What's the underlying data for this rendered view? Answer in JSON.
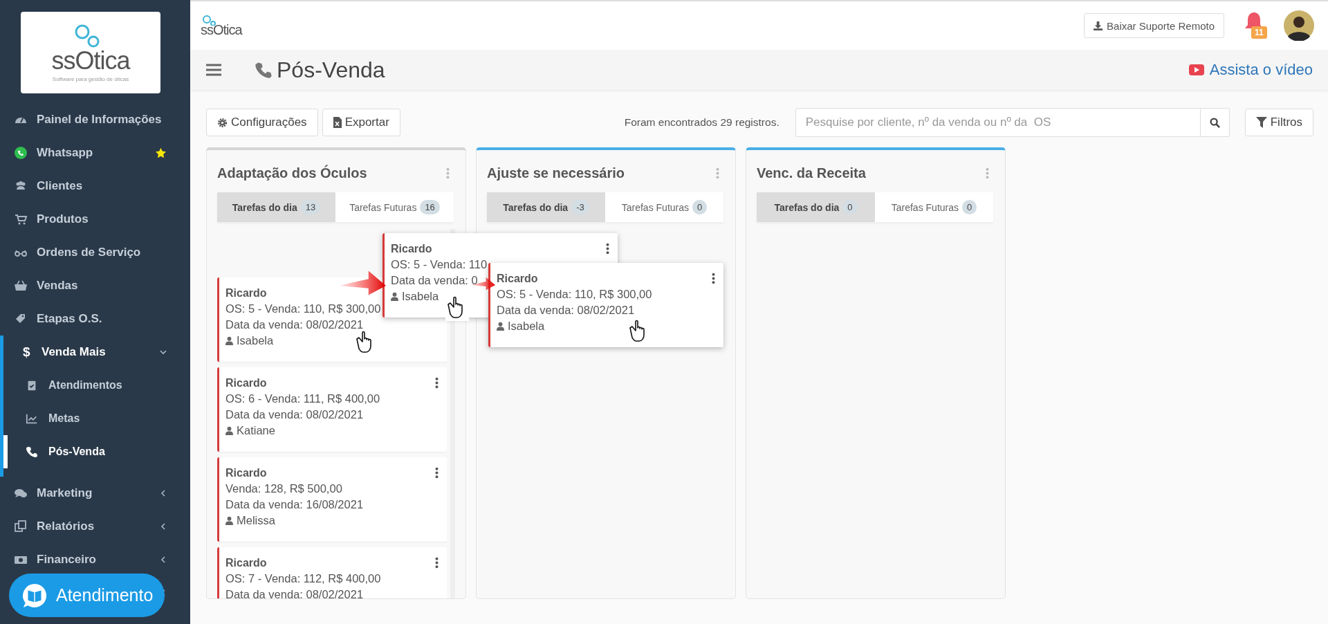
{
  "sidebar": {
    "logo": {
      "name": "ssOtica",
      "tagline": "Software para gestão de óticas"
    },
    "items": [
      {
        "label": "Painel de Informações",
        "starred": false
      },
      {
        "label": "Whatsapp",
        "starred": true
      },
      {
        "label": "Clientes",
        "starred": false
      },
      {
        "label": "Produtos",
        "starred": false
      },
      {
        "label": "Ordens de Serviço",
        "starred": false
      },
      {
        "label": "Vendas",
        "starred": false
      },
      {
        "label": "Etapas O.S.",
        "starred": false
      },
      {
        "label": "Venda Mais",
        "glyph": "$",
        "starred": false,
        "expanded": true,
        "children": [
          {
            "label": "Atendimentos",
            "selected": false
          },
          {
            "label": "Metas",
            "selected": false
          },
          {
            "label": "Pós-Venda",
            "selected": true
          }
        ]
      },
      {
        "label": "Marketing",
        "starred": false,
        "expanded": false
      },
      {
        "label": "Relatórios",
        "starred": false,
        "expanded": false
      },
      {
        "label": "Financeiro",
        "starred": false,
        "expanded": false
      }
    ],
    "help_button": {
      "label": "Atendimento"
    }
  },
  "header": {
    "logo": "ssOtica",
    "download_button": "Baixar Suporte Remoto",
    "notifications": {
      "count": "11"
    }
  },
  "title_bar": {
    "title": "Pós-Venda",
    "video_link": "Assista o vídeo"
  },
  "toolbar": {
    "buttons": [
      "Configurações",
      "Exportar"
    ],
    "result_count": "Foram encontrados 29 registros.",
    "search": {
      "placeholder": "Pesquise por cliente, nº da venda ou nº da  OS"
    },
    "filter_button": "Filtros"
  },
  "columns": [
    {
      "title": "Adaptação dos Óculos",
      "color": "#d5d5d5",
      "tabs": [
        {
          "label": "Tarefas do dia",
          "count": "13",
          "selected": true
        },
        {
          "label": "Tarefas Futuras",
          "count": "16",
          "selected": false
        }
      ],
      "drop_slot": true,
      "cards": [
        {
          "name": "Ricardo",
          "details": "OS: 5 - Venda: 110, R$ 300,00",
          "date": "Data da venda: 08/02/2021",
          "seller": "Isabela"
        },
        {
          "name": "Ricardo",
          "details": "OS: 6 - Venda: 111, R$ 400,00",
          "date": "Data da venda: 08/02/2021",
          "seller": "Katiane"
        },
        {
          "name": "Ricardo",
          "details": "Venda: 128, R$ 500,00",
          "date": "Data da venda: 16/08/2021",
          "seller": "Melissa"
        },
        {
          "name": "Ricardo",
          "details": "OS: 7 - Venda: 112, R$ 400,00",
          "date": "Data da venda: 08/02/2021"
        }
      ]
    },
    {
      "title": "Ajuste se necessário",
      "color": "#4aaee8",
      "tabs": [
        {
          "label": "Tarefas do dia",
          "count": "-3",
          "selected": true
        },
        {
          "label": "Tarefas Futuras",
          "count": "0",
          "selected": false
        }
      ]
    },
    {
      "title": "Venc. da Receita",
      "color": "#4aaee8",
      "tabs": [
        {
          "label": "Tarefas do dia",
          "count": "0",
          "selected": true
        },
        {
          "label": "Tarefas Futuras",
          "count": "0",
          "selected": false
        }
      ]
    }
  ],
  "drag_demo": {
    "ghost_card": {
      "name": "Ricardo",
      "details": "OS: 5 - Venda: 110",
      "date": "Data da venda: 0",
      "seller": "Isabela"
    },
    "dropped_card": {
      "name": "Ricardo",
      "details": "OS: 5 - Venda: 110, R$ 300,00",
      "date": "Data da venda: 08/02/2021",
      "seller": "Isabela"
    }
  }
}
